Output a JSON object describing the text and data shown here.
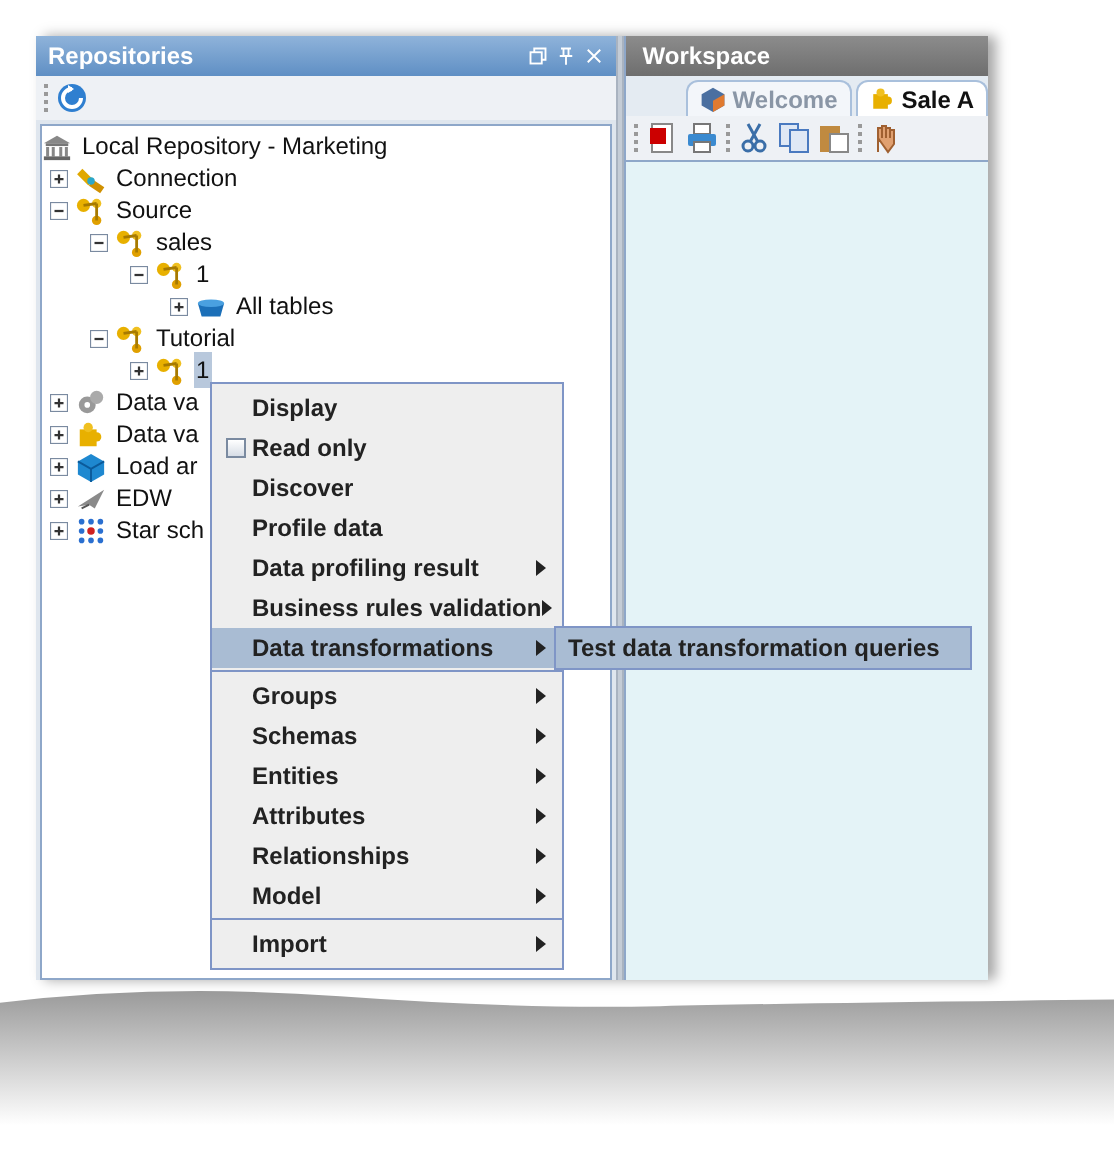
{
  "repositories": {
    "title": "Repositories",
    "tree": [
      {
        "label": "Local Repository - Marketing",
        "kind": "repository",
        "selected": false,
        "children": [
          {
            "label": "Connection",
            "kind": "connection",
            "expanded": false,
            "selected": false
          },
          {
            "label": "Source",
            "kind": "source",
            "expanded": true,
            "selected": false,
            "children": [
              {
                "label": "sales",
                "kind": "source",
                "expanded": true,
                "selected": false,
                "children": [
                  {
                    "label": "1",
                    "kind": "source",
                    "expanded": true,
                    "selected": false,
                    "children": [
                      {
                        "label": "All tables",
                        "kind": "tables",
                        "expanded": false,
                        "selected": false
                      }
                    ]
                  }
                ]
              },
              {
                "label": "Tutorial",
                "kind": "source",
                "expanded": true,
                "selected": false,
                "children": [
                  {
                    "label": "1",
                    "kind": "source",
                    "expanded": false,
                    "selected": true
                  }
                ]
              }
            ]
          },
          {
            "label": "Data va",
            "kind": "validation",
            "expanded": false,
            "selected": false
          },
          {
            "label": "Data va",
            "kind": "rules",
            "expanded": false,
            "selected": false
          },
          {
            "label": "Load ar",
            "kind": "load",
            "expanded": false,
            "selected": false
          },
          {
            "label": "EDW",
            "kind": "edw",
            "expanded": false,
            "selected": false
          },
          {
            "label": "Star sch",
            "kind": "star",
            "expanded": false,
            "selected": false
          }
        ]
      }
    ]
  },
  "workspace": {
    "title": "Workspace",
    "tabs": [
      {
        "label": "Welcome",
        "selected": false
      },
      {
        "label": "Sale A",
        "selected": true
      }
    ]
  },
  "context_menu": [
    {
      "kind": "item",
      "label": "Display",
      "selected": false
    },
    {
      "kind": "checkbox",
      "label": "Read only",
      "checked": false,
      "selected": false
    },
    {
      "kind": "item",
      "label": "Discover",
      "selected": false
    },
    {
      "kind": "item",
      "label": "Profile data",
      "selected": false
    },
    {
      "kind": "submenu",
      "label": "Data profiling result",
      "selected": false
    },
    {
      "kind": "submenu",
      "label": "Business rules validation",
      "selected": false
    },
    {
      "kind": "submenu",
      "label": "Data transformations",
      "selected": true,
      "submenu": [
        {
          "label": "Test data transformation queries"
        }
      ]
    },
    {
      "kind": "separator"
    },
    {
      "kind": "submenu",
      "label": "Groups",
      "selected": false
    },
    {
      "kind": "submenu",
      "label": "Schemas",
      "selected": false
    },
    {
      "kind": "submenu",
      "label": "Entities",
      "selected": false
    },
    {
      "kind": "submenu",
      "label": "Attributes",
      "selected": false
    },
    {
      "kind": "submenu",
      "label": "Relationships",
      "selected": false
    },
    {
      "kind": "submenu",
      "label": "Model",
      "selected": false
    },
    {
      "kind": "separator"
    },
    {
      "kind": "submenu",
      "label": "Import",
      "selected": false
    }
  ]
}
